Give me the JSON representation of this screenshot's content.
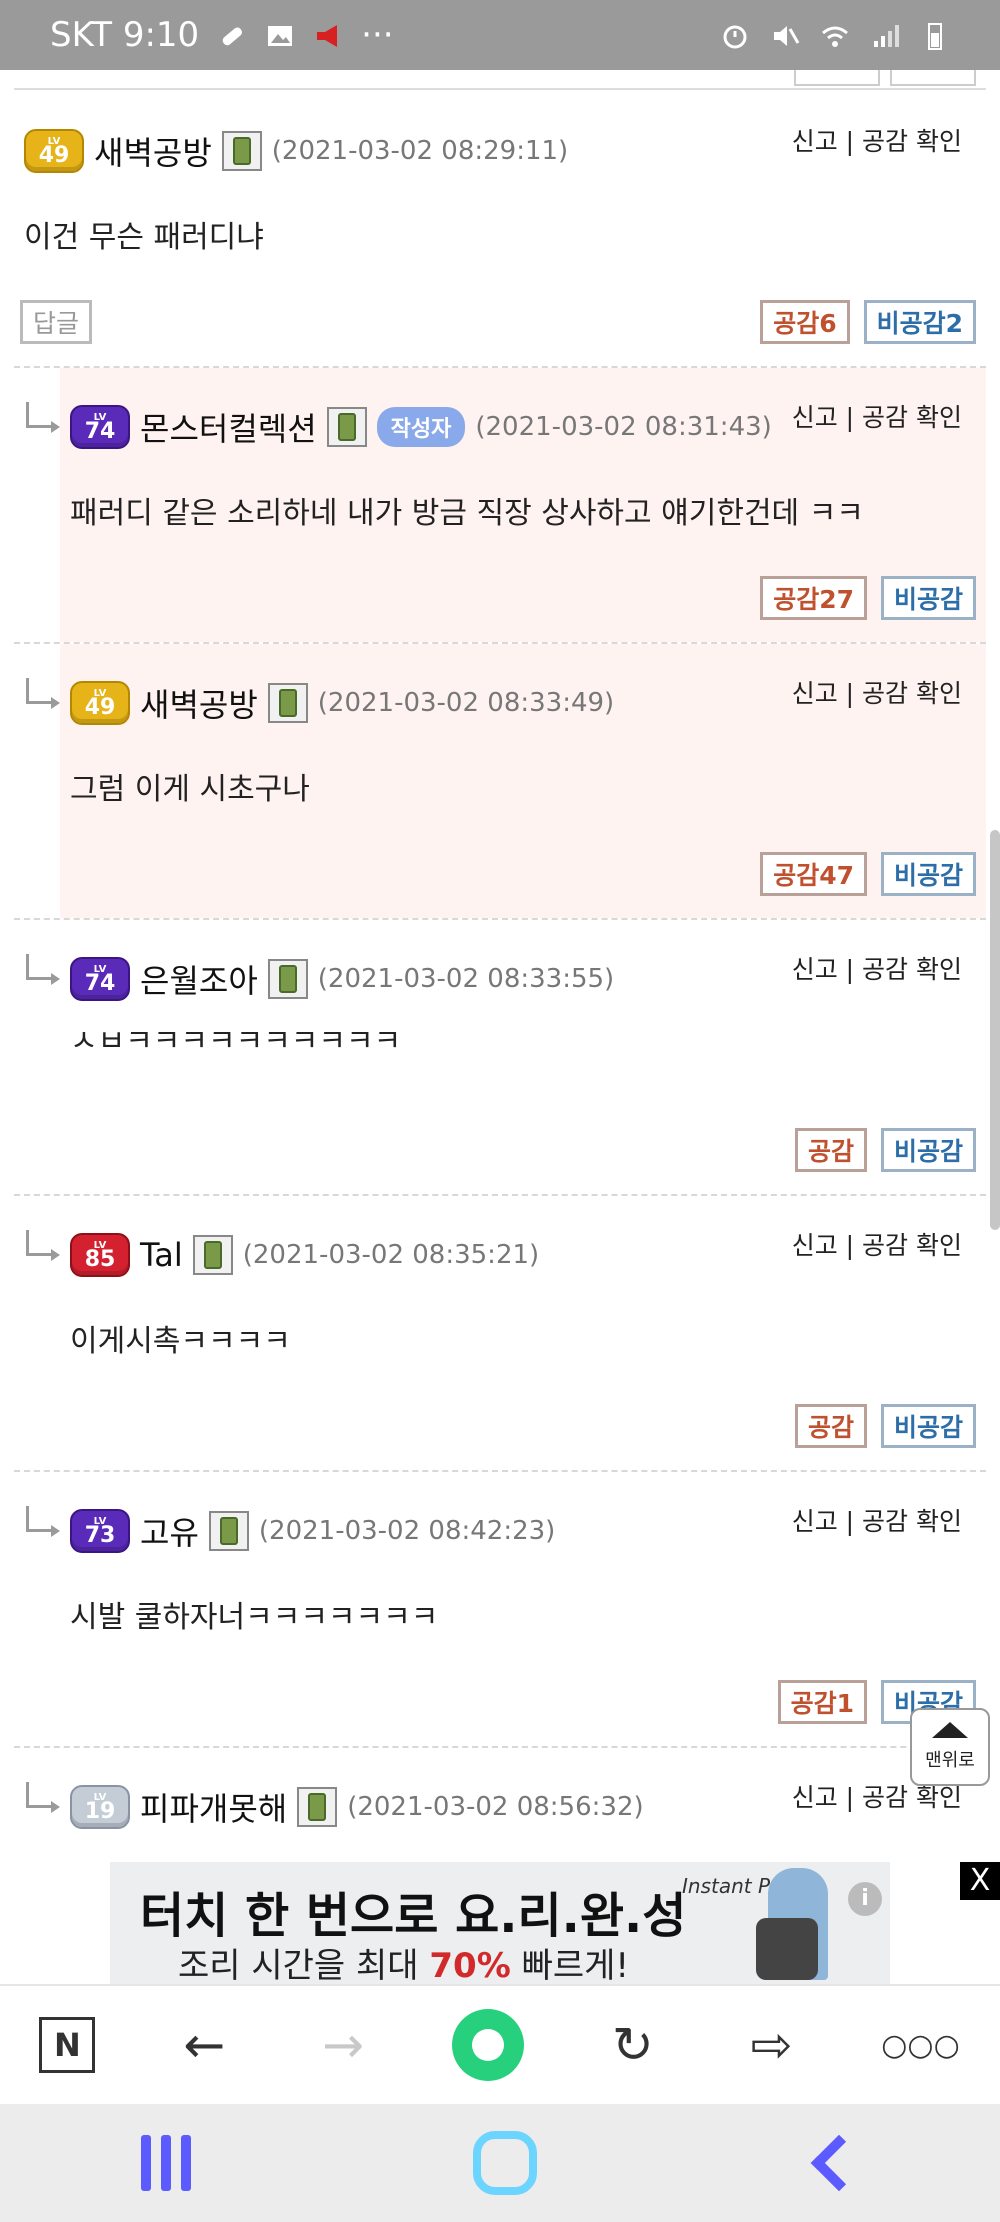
{
  "status_bar": {
    "carrier_time": "SKT 9:10",
    "more": "···"
  },
  "comments": [
    {
      "level": "49",
      "level_color": "gold",
      "nickname": "새벽공방",
      "time": "(2021-03-02 08:29:11)",
      "text": "이건 무슨 패러디냐",
      "reply_label": "답글",
      "like": "공감6",
      "dislike": "비공감2",
      "report": "신고 | 공감 확인"
    },
    {
      "level": "74",
      "level_color": "purple",
      "nickname": "몬스터컬렉션",
      "author_badge": "작성자",
      "time": "(2021-03-02 08:31:43)",
      "text": "패러디 같은 소리하네 내가 방금 직장 상사하고 얘기한건데 ㅋㅋ",
      "like": "공감27",
      "dislike": "비공감",
      "report": "신고 | 공감 확인"
    },
    {
      "level": "49",
      "level_color": "gold",
      "nickname": "새벽공방",
      "time": "(2021-03-02 08:33:49)",
      "text": "그럼 이게 시초구나",
      "like": "공감47",
      "dislike": "비공감",
      "report": "신고 | 공감 확인"
    },
    {
      "level": "74",
      "level_color": "purple",
      "nickname": "은월조아",
      "time": "(2021-03-02 08:33:55)",
      "text": "ㅅㅂㅋㅋㅋㅋㅋㅋㅋㅋㅋㅋ",
      "like": "공감",
      "dislike": "비공감",
      "report": "신고 | 공감 확인"
    },
    {
      "level": "85",
      "level_color": "red",
      "nickname": "Tal",
      "time": "(2021-03-02 08:35:21)",
      "text": "이게시촉ㅋㅋㅋㅋ",
      "like": "공감",
      "dislike": "비공감",
      "report": "신고 | 공감 확인"
    },
    {
      "level": "73",
      "level_color": "purple",
      "nickname": "고유",
      "time": "(2021-03-02 08:42:23)",
      "text": "시발 쿨하자너ㅋㅋㅋㅋㅋㅋㅋ",
      "like": "공감1",
      "dislike": "비공감",
      "report": "신고 | 공감 확인"
    },
    {
      "level": "19",
      "level_color": "silver",
      "nickname": "피파개못해",
      "time": "(2021-03-02 08:56:32)",
      "report": "신고 | 공감 확인"
    }
  ],
  "to_top": "맨위로",
  "ad": {
    "headline": "터치 한 번으로 요.리.완.성",
    "sub_prefix": "조리 시간을 최대 ",
    "sub_highlight": "70%",
    "sub_suffix": " 빠르게!",
    "brand": "Instant Pot",
    "info": "i",
    "close": "X"
  },
  "toolbar": {
    "home_letter": "N",
    "back": "←",
    "forward": "→",
    "refresh": "↻",
    "share": "⇨",
    "more": "○○○"
  }
}
